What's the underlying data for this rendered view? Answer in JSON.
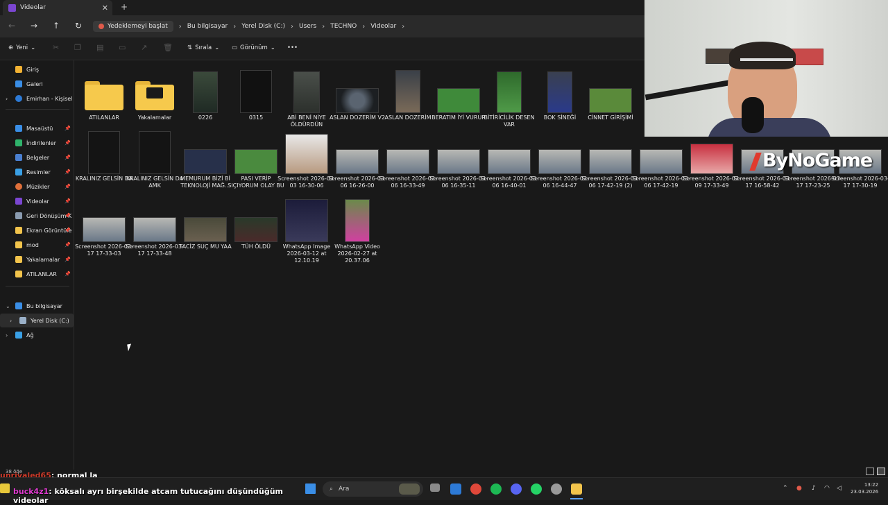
{
  "window": {
    "tab_title": "Videolar",
    "close": "✕",
    "new_tab": "+"
  },
  "nav": {
    "back": "←",
    "forward": "→",
    "up": "↑",
    "refresh": "↻",
    "backup": "Yedeklemeyi başlat"
  },
  "breadcrumb": [
    "Bu bilgisayar",
    "Yerel Disk (C:)",
    "Users",
    "TECHNO",
    "Videolar"
  ],
  "toolbar": {
    "new": "Yeni",
    "sort": "Sırala",
    "view": "Görünüm",
    "more": "•••"
  },
  "sidebar": {
    "home": "Giriş",
    "gallery": "Galeri",
    "personal": "Emirhan - Kişisel",
    "quick": [
      "Masaüstü",
      "İndirilenler",
      "Belgeler",
      "Resimler",
      "Müzikler",
      "Videolar",
      "Geri Dönüşüm K",
      "Ekran Görüntüle",
      "mod",
      "Yakalamalar",
      "ATILANLAR"
    ],
    "this_pc": "Bu bilgisayar",
    "local_disk": "Yerel Disk (C:)",
    "network": "Ağ"
  },
  "files": [
    [
      "ATILANLAR",
      "Yakalamalar",
      "0226",
      "0315",
      "ABİ BENİ NİYE ÖLDÜRDÜN",
      "ASLAN DOZERİM V2",
      "ASLAN DOZERİM",
      "BERATIM İYİ VURUR",
      "BİTİRİCİLİK DESEN VAR",
      "BOK SİNEĞİ",
      "CİNNET GİRİŞİMİ"
    ],
    [
      "KRALINIZ GELSİN DA",
      "KRALINIZ GELSİN DA AMK",
      "MEMURUM BİZİ Bİ TEKNOLOJİ MAĞ...",
      "PASI VERİP SIÇIYORUM OLAY BU",
      "Screenshot 2026-03-03 16-30-06",
      "Screenshot 2026-03-06 16-26-00",
      "Screenshot 2026-03-06 16-33-49",
      "Screenshot 2026-03-06 16-35-11",
      "Screenshot 2026-03-06 16-40-01",
      "Screenshot 2026-03-06 16-44-47",
      "Screenshot 2026-03-06 17-42-19 (2)",
      "Screenshot 2026-03-06 17-42-19",
      "Screenshot 2026-03-09 17-33-49",
      "Screenshot 2026-03-17 16-58-42",
      "Screenshot 2026-03-17 17-23-25",
      "Screenshot 2026-03-17 17-30-19"
    ],
    [
      "Screenshot 2026-03-17 17-33-03",
      "Screenshot 2026-03-17 17-33-48",
      "TACİZ SUÇ MU YAA",
      "TÜH ÖLDÜ",
      "WhatsApp Image 2026-03-12 at 12.10.19",
      "WhatsApp Video 2026-02-27 at 20.37.06"
    ]
  ],
  "status": {
    "count": "38 öğe"
  },
  "overlay": {
    "watermark": "ByNoGame",
    "chat": [
      {
        "user": "unrivaled65",
        "msg": ": normal la"
      },
      {
        "user": "buck4z1",
        "msg": ": köksalı ayrı birşekilde atcam tutucağını düşündüğüm videolar"
      }
    ]
  },
  "taskbar": {
    "search": "Ara",
    "time": "13:22",
    "date": "23.03.2026"
  }
}
